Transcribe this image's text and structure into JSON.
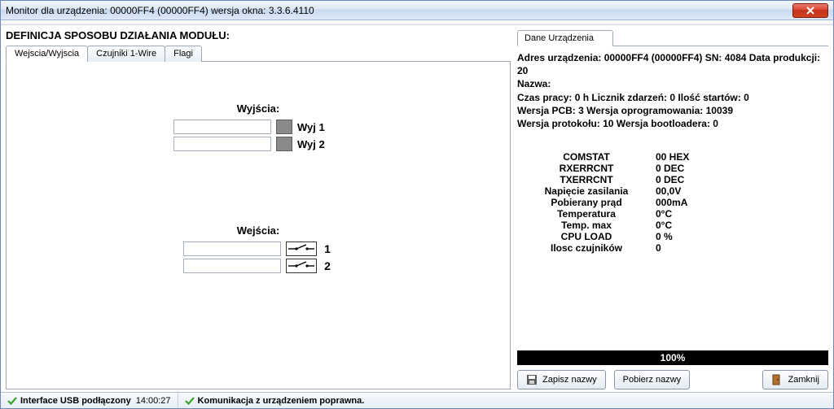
{
  "window": {
    "title": "Monitor dla urządzenia: 00000FF4 (00000FF4)   wersja okna: 3.3.6.4110"
  },
  "left": {
    "section_title": "DEFINICJA SPOSOBU DZIAŁANIA MODUŁU:",
    "tabs": {
      "t0": "Wejscia/Wyjscia",
      "t1": "Czujniki 1-Wire",
      "t2": "Flagi"
    },
    "outputs": {
      "label": "Wyjścia:",
      "o1": {
        "value": "",
        "label": "Wyj 1"
      },
      "o2": {
        "value": "",
        "label": "Wyj 2"
      }
    },
    "inputs": {
      "label": "Wejścia:",
      "i1": {
        "value": "",
        "num": "1"
      },
      "i2": {
        "value": "",
        "num": "2"
      }
    }
  },
  "right": {
    "tab": "Dane Urządzenia",
    "info_l1": "Adres urządzenia: 00000FF4 (00000FF4)  SN: 4084 Data produkcji: 20",
    "info_l2": "Nazwa:",
    "info_l3": "Czas pracy: 0 h Licznik zdarzeń: 0 Ilość startów: 0",
    "info_l4": "Wersja PCB: 3 Wersja oprogramowania: 10039",
    "info_l5": "Wersja protokołu: 10 Wersja bootloadera: 0",
    "stats": {
      "s1": {
        "label": "COMSTAT",
        "val": "00 HEX"
      },
      "s2": {
        "label": "RXERRCNT",
        "val": "0 DEC"
      },
      "s3": {
        "label": "TXERRCNT",
        "val": "0 DEC"
      },
      "s4": {
        "label": "Napięcie zasilania",
        "val": "00,0V"
      },
      "s5": {
        "label": "Pobierany prąd",
        "val": "000mA"
      },
      "s6": {
        "label": "Temperatura",
        "val": "0°C"
      },
      "s7": {
        "label": "Temp. max",
        "val": "0°C"
      },
      "s8": {
        "label": "CPU LOAD",
        "val": "0 %"
      },
      "s9": {
        "label": "Ilosc czujników",
        "val": "0"
      }
    },
    "progress": "100%",
    "buttons": {
      "save": "Zapisz nazwy",
      "fetch": "Pobierz nazwy",
      "close": "Zamknij"
    }
  },
  "status": {
    "usb": "Interface USB podłączony",
    "time": "14:00:27",
    "comm": "Komunikacja z urządzeniem poprawna."
  }
}
